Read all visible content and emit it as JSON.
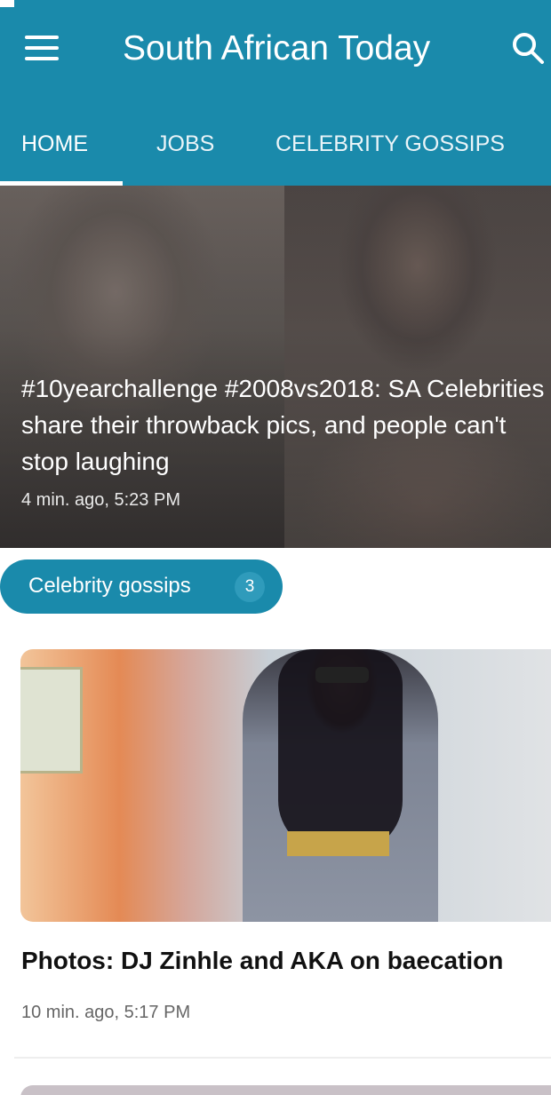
{
  "app": {
    "title": "South African Today"
  },
  "tabs": [
    {
      "label": "HOME",
      "active": true
    },
    {
      "label": "JOBS",
      "active": false
    },
    {
      "label": "CELEBRITY GOSSIPS",
      "active": false
    }
  ],
  "hero": {
    "title": "#10yearchallenge #2008vs2018: SA Celebrities\nshare their throwback pics, and people can't\nstop laughing",
    "time": "4 min. ago, 5:23 PM"
  },
  "category_chip": {
    "label": "Celebrity gossips",
    "count": "3"
  },
  "articles": [
    {
      "title": "Photos: DJ Zinhle and AKA on baecation",
      "time": "10 min. ago, 5:17 PM"
    }
  ],
  "colors": {
    "primary": "#1a8aab",
    "on_primary": "#ffffff"
  },
  "icons": {
    "menu": "menu-icon",
    "search": "search-icon"
  }
}
